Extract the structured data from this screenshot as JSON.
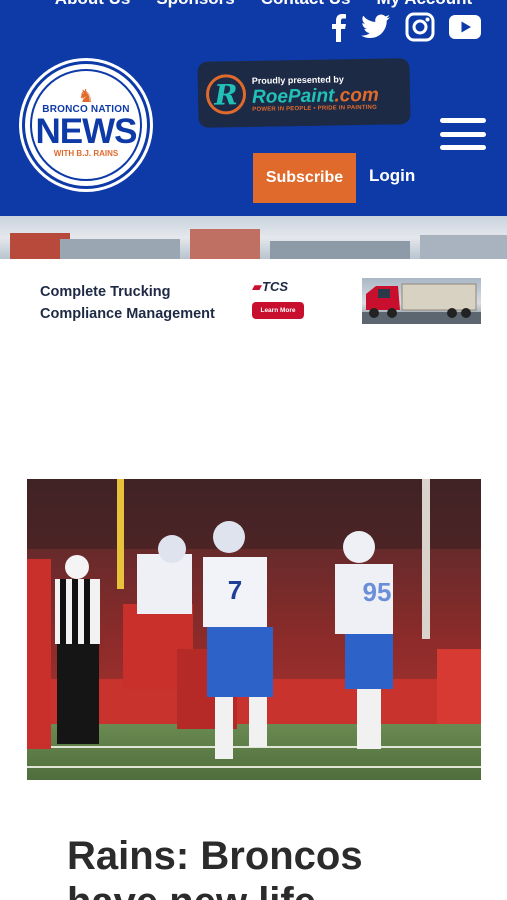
{
  "header": {
    "top_nav": [
      "About Us",
      "Sponsors",
      "Contact Us",
      "My Account"
    ],
    "social_icons": [
      "facebook-icon",
      "twitter-icon",
      "instagram-icon",
      "youtube-icon"
    ],
    "logo": {
      "top_text": "BRONCO NATION",
      "main_text": "NEWS",
      "sub_text": "WITH B.J. RAINS"
    },
    "sponsor": {
      "pre_text": "Proudly presented by",
      "brand": "RoePaint",
      "brand_suffix": ".com",
      "tagline": "POWER IN PEOPLE • PRIDE IN PAINTING"
    },
    "subscribe_label": "Subscribe",
    "login_label": "Login"
  },
  "ad": {
    "line1": "Complete Trucking",
    "line2": "Compliance Management",
    "brand": "TCS",
    "button_label": "Learn More"
  },
  "article": {
    "headline_line1": "Rains: Broncos",
    "headline_line2": "have new life"
  },
  "colors": {
    "header_blue": "#0e3aa8",
    "accent_orange": "#e06a2b",
    "headline_text": "#2b2b2b"
  }
}
